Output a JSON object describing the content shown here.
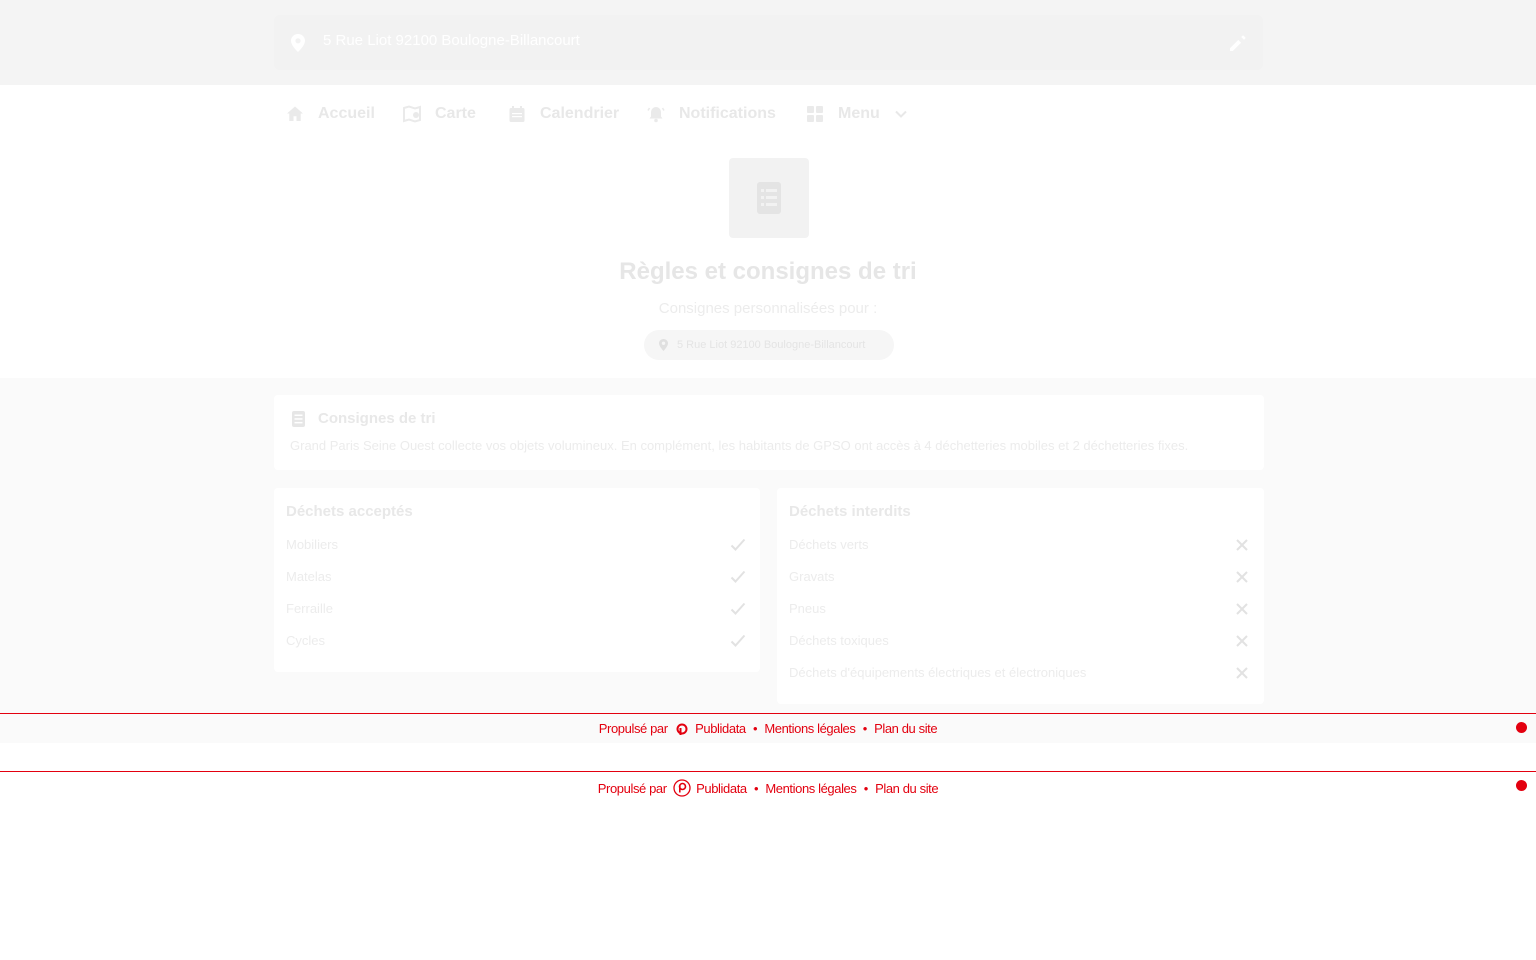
{
  "address_bar": {
    "address": "5 Rue Liot 92100 Boulogne-Billancourt",
    "pin_icon": "map-pin-icon",
    "edit_icon": "pencil-icon"
  },
  "nav": {
    "items": [
      {
        "label": "Accueil",
        "icon": "home-icon"
      },
      {
        "label": "Carte",
        "icon": "map-icon"
      },
      {
        "label": "Calendrier",
        "icon": "calendar-icon"
      },
      {
        "label": "Notifications",
        "icon": "bell-icon"
      },
      {
        "label": "Menu",
        "icon": "grid-icon"
      }
    ]
  },
  "hero": {
    "icon": "document-list-icon",
    "title": "Règles et consignes de tri",
    "subtitle": "Consignes personnalisées pour :",
    "address_chip": "5 Rue Liot 92100 Boulogne-Billancourt"
  },
  "info": {
    "title": "Consignes de tri",
    "description": "Grand Paris Seine Ouest collecte vos objets volumineux. En complément, les habitants de GPSO ont accès à 4 déchetteries mobiles et 2 déchetteries fixes."
  },
  "accepted": {
    "title": "Déchets acceptés",
    "items": [
      "Mobiliers",
      "Matelas",
      "Ferraille",
      "Cycles"
    ]
  },
  "forbidden": {
    "title": "Déchets interdits",
    "items": [
      "Déchets verts",
      "Gravats",
      "Pneus",
      "Déchets toxiques",
      "Déchets d'équipements électriques et électroniques"
    ]
  },
  "footer": {
    "powered_by": "Propulsé par",
    "brand": "Publidata",
    "legal": "Mentions légales",
    "sitemap": "Plan du site",
    "separator": "•"
  },
  "colors": {
    "accent": "#e3000f",
    "background": "#fafafa"
  }
}
